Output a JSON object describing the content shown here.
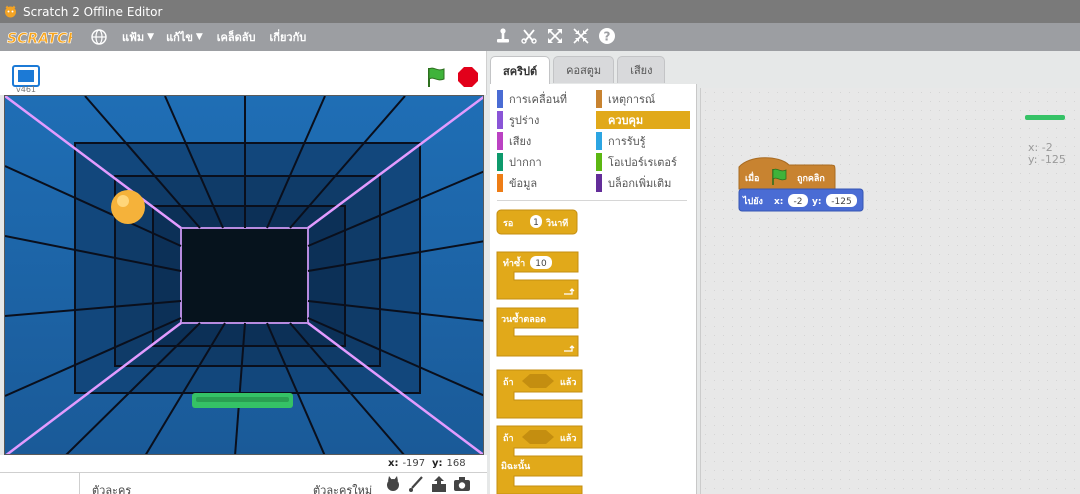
{
  "window": {
    "title": "Scratch 2 Offline Editor"
  },
  "menubar": {
    "logo_text": "SCRATCH",
    "menus": [
      {
        "label": "แฟ้ม",
        "has_caret": true
      },
      {
        "label": "แก้ไข",
        "has_caret": true
      },
      {
        "label": "เคล็ดลับ",
        "has_caret": false
      },
      {
        "label": "เกี่ยวกับ",
        "has_caret": false
      }
    ],
    "tools": [
      "duplicate-stamp-icon",
      "cut-scissors-icon",
      "grow-icon",
      "shrink-icon",
      "help-icon"
    ]
  },
  "stage": {
    "version": "v461",
    "coords": {
      "x_label": "x:",
      "x_value": "-197",
      "y_label": "y:",
      "y_value": "168"
    },
    "ball_color": "#f5b23a",
    "paddle_color": "#35c266"
  },
  "sprites": {
    "label": "ตัวละคร",
    "new_sprite_label": "ตัวละครใหม่"
  },
  "tabs": [
    {
      "label": "สคริปต์",
      "active": true
    },
    {
      "label": "คอสตูม",
      "active": false
    },
    {
      "label": "เสียง",
      "active": false
    }
  ],
  "categories": [
    {
      "label": "การเคลื่อนที่",
      "color": "#4a6cd4",
      "selected": false
    },
    {
      "label": "เหตุการณ์",
      "color": "#c88330",
      "selected": false
    },
    {
      "label": "รูปร่าง",
      "color": "#8a55d7",
      "selected": false
    },
    {
      "label": "ควบคุม",
      "color": "#e1a91a",
      "selected": true
    },
    {
      "label": "เสียง",
      "color": "#bb42c3",
      "selected": false
    },
    {
      "label": "การรับรู้",
      "color": "#2ca5e2",
      "selected": false
    },
    {
      "label": "ปากกา",
      "color": "#0e9a6c",
      "selected": false
    },
    {
      "label": "โอเปอร์เรเตอร์",
      "color": "#5cb712",
      "selected": false
    },
    {
      "label": "ข้อมูล",
      "color": "#ee7d16",
      "selected": false
    },
    {
      "label": "บล็อกเพิ่มเติม",
      "color": "#632d99",
      "selected": false
    }
  ],
  "palette_blocks": {
    "wait": {
      "label": "รอ",
      "value": "1",
      "unit": "วินาที"
    },
    "repeat": {
      "label": "ทำซ้ำ",
      "value": "10"
    },
    "forever": {
      "label": "วนซ้ำตลอด"
    },
    "if_then": {
      "label_if": "ถ้า",
      "label_then": "แล้ว"
    },
    "if_else": {
      "label_if": "ถ้า",
      "label_then": "แล้ว",
      "label_else": "มิฉะนั้น"
    }
  },
  "script": {
    "hat": {
      "label_when": "เมื่อ",
      "label_clicked": "ถูกคลิก"
    },
    "goto": {
      "label": "ไปยัง",
      "x_label": "x:",
      "x_value": "-2",
      "y_label": "y:",
      "y_value": "-125"
    }
  },
  "sprite_info": {
    "x_label": "x:",
    "x_value": "-2",
    "y_label": "y:",
    "y_value": "-125"
  },
  "colors": {
    "control": "#e1a91a",
    "events": "#c88330",
    "motion": "#4a6cd4"
  }
}
